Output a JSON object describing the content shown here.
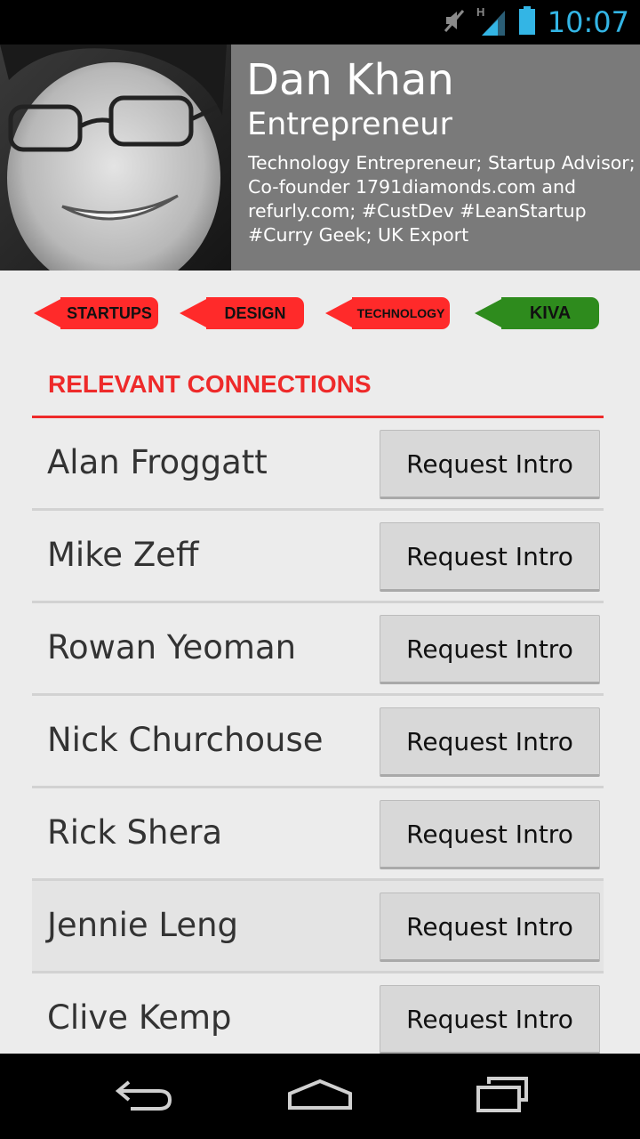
{
  "status_bar": {
    "time": "10:07",
    "network_label": "H",
    "icons": [
      "mute-icon",
      "signal-icon",
      "battery-icon"
    ],
    "accent_color": "#33b5e5"
  },
  "profile": {
    "name": "Dan Khan",
    "title": "Entrepreneur",
    "bio": "Technology Entrepreneur; Startup Advisor; Co-founder 1791diamonds.com and refurly.com; #CustDev #LeanStartup #Curry Geek; UK Export",
    "header_color": "#7a7a7a"
  },
  "tags": [
    {
      "label": "STARTUPS",
      "color": "#ff2a2a"
    },
    {
      "label": "DESIGN",
      "color": "#ff2a2a"
    },
    {
      "label": "TECHNOLOGY",
      "color": "#ff2a2a"
    },
    {
      "label": "KIVA",
      "color": "#2e8b1d"
    }
  ],
  "connections": {
    "title": "RELEVANT CONNECTIONS",
    "accent_color": "#ee2a2a",
    "button_label": "Request Intro",
    "people": [
      {
        "name": "Alan Froggatt",
        "button": "Request Intro"
      },
      {
        "name": "Mike Zeff",
        "button": "Request Intro"
      },
      {
        "name": "Rowan Yeoman",
        "button": "Request Intro"
      },
      {
        "name": "Nick Churchouse",
        "button": "Request Intro"
      },
      {
        "name": "Rick Shera",
        "button": "Request Intro"
      },
      {
        "name": "Jennie Leng",
        "button": "Request Intro"
      },
      {
        "name": "Clive Kemp",
        "button": "Request Intro"
      }
    ]
  },
  "nav_bar": {
    "icons": [
      "back-icon",
      "home-icon",
      "recent-apps-icon"
    ]
  }
}
